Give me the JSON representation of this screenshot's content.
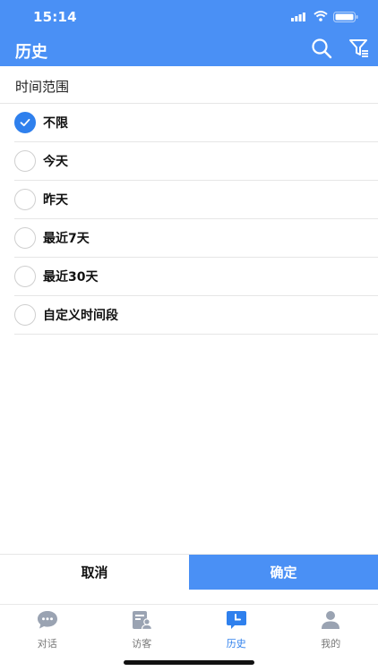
{
  "status_bar": {
    "time": "15:14"
  },
  "header": {
    "title": "历史",
    "search_icon": "search-icon",
    "filter_icon": "filter-icon"
  },
  "section": {
    "title": "时间范围"
  },
  "options": [
    {
      "label": "不限",
      "checked": true
    },
    {
      "label": "今天",
      "checked": false
    },
    {
      "label": "昨天",
      "checked": false
    },
    {
      "label": "最近7天",
      "checked": false
    },
    {
      "label": "最近30天",
      "checked": false
    },
    {
      "label": "自定义时间段",
      "checked": false
    }
  ],
  "actions": {
    "cancel": "取消",
    "confirm": "确定"
  },
  "tabs": [
    {
      "label": "对话",
      "icon": "chat-icon",
      "active": false
    },
    {
      "label": "访客",
      "icon": "visitor-icon",
      "active": false
    },
    {
      "label": "历史",
      "icon": "history-icon",
      "active": true
    },
    {
      "label": "我的",
      "icon": "profile-icon",
      "active": false
    }
  ],
  "colors": {
    "primary": "#4a90f5",
    "check": "#2f80ed",
    "tab_inactive": "#9aa3b2",
    "tab_active": "#2f80ed"
  }
}
